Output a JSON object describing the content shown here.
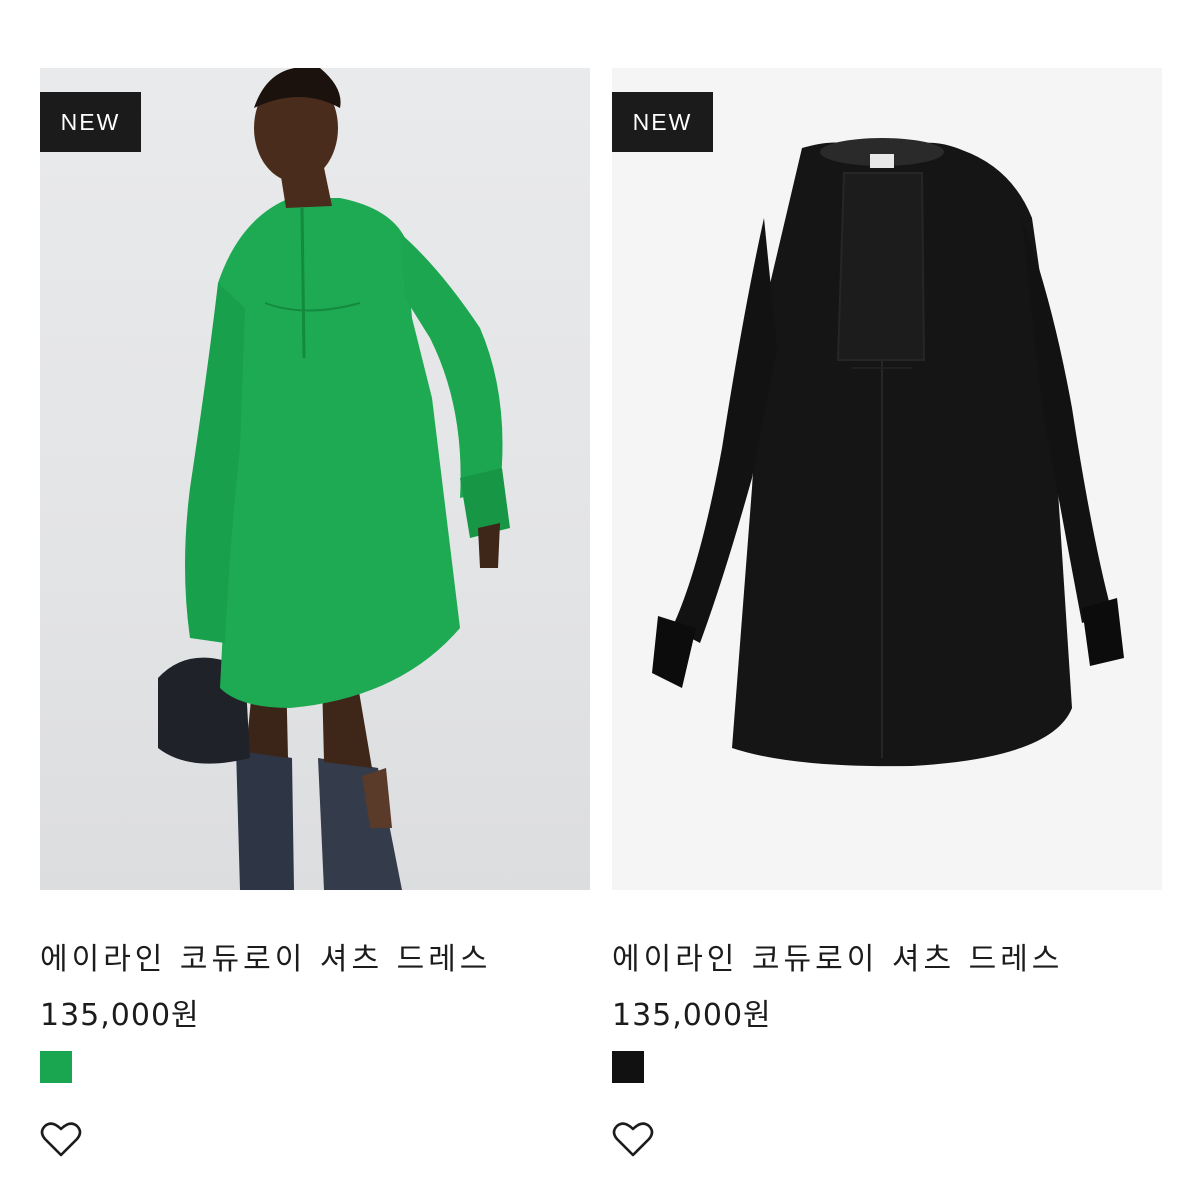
{
  "products": [
    {
      "badge": "NEW",
      "name": "에이라인 코듀로이 셔츠 드레스",
      "price": "135,000원",
      "swatch_color": "#1aa551",
      "image_subject": "model-in-green-dress",
      "wishlist_icon": "heart-outline-icon"
    },
    {
      "badge": "NEW",
      "name": "에이라인 코듀로이 셔츠 드레스",
      "price": "135,000원",
      "swatch_color": "#111111",
      "image_subject": "black-dress-flat",
      "wishlist_icon": "heart-outline-icon"
    }
  ]
}
